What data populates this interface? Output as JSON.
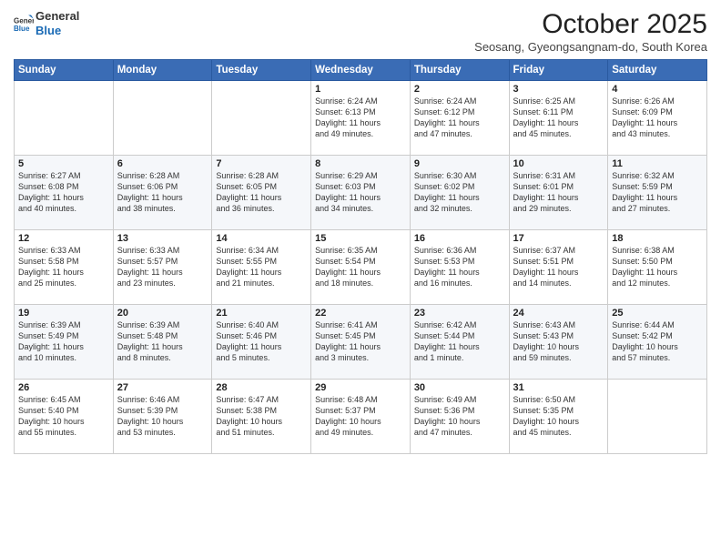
{
  "logo": {
    "line1": "General",
    "line2": "Blue"
  },
  "title": "October 2025",
  "subtitle": "Seosang, Gyeongsangnam-do, South Korea",
  "days_of_week": [
    "Sunday",
    "Monday",
    "Tuesday",
    "Wednesday",
    "Thursday",
    "Friday",
    "Saturday"
  ],
  "weeks": [
    [
      {
        "day": "",
        "info": ""
      },
      {
        "day": "",
        "info": ""
      },
      {
        "day": "",
        "info": ""
      },
      {
        "day": "1",
        "info": "Sunrise: 6:24 AM\nSunset: 6:13 PM\nDaylight: 11 hours\nand 49 minutes."
      },
      {
        "day": "2",
        "info": "Sunrise: 6:24 AM\nSunset: 6:12 PM\nDaylight: 11 hours\nand 47 minutes."
      },
      {
        "day": "3",
        "info": "Sunrise: 6:25 AM\nSunset: 6:11 PM\nDaylight: 11 hours\nand 45 minutes."
      },
      {
        "day": "4",
        "info": "Sunrise: 6:26 AM\nSunset: 6:09 PM\nDaylight: 11 hours\nand 43 minutes."
      }
    ],
    [
      {
        "day": "5",
        "info": "Sunrise: 6:27 AM\nSunset: 6:08 PM\nDaylight: 11 hours\nand 40 minutes."
      },
      {
        "day": "6",
        "info": "Sunrise: 6:28 AM\nSunset: 6:06 PM\nDaylight: 11 hours\nand 38 minutes."
      },
      {
        "day": "7",
        "info": "Sunrise: 6:28 AM\nSunset: 6:05 PM\nDaylight: 11 hours\nand 36 minutes."
      },
      {
        "day": "8",
        "info": "Sunrise: 6:29 AM\nSunset: 6:03 PM\nDaylight: 11 hours\nand 34 minutes."
      },
      {
        "day": "9",
        "info": "Sunrise: 6:30 AM\nSunset: 6:02 PM\nDaylight: 11 hours\nand 32 minutes."
      },
      {
        "day": "10",
        "info": "Sunrise: 6:31 AM\nSunset: 6:01 PM\nDaylight: 11 hours\nand 29 minutes."
      },
      {
        "day": "11",
        "info": "Sunrise: 6:32 AM\nSunset: 5:59 PM\nDaylight: 11 hours\nand 27 minutes."
      }
    ],
    [
      {
        "day": "12",
        "info": "Sunrise: 6:33 AM\nSunset: 5:58 PM\nDaylight: 11 hours\nand 25 minutes."
      },
      {
        "day": "13",
        "info": "Sunrise: 6:33 AM\nSunset: 5:57 PM\nDaylight: 11 hours\nand 23 minutes."
      },
      {
        "day": "14",
        "info": "Sunrise: 6:34 AM\nSunset: 5:55 PM\nDaylight: 11 hours\nand 21 minutes."
      },
      {
        "day": "15",
        "info": "Sunrise: 6:35 AM\nSunset: 5:54 PM\nDaylight: 11 hours\nand 18 minutes."
      },
      {
        "day": "16",
        "info": "Sunrise: 6:36 AM\nSunset: 5:53 PM\nDaylight: 11 hours\nand 16 minutes."
      },
      {
        "day": "17",
        "info": "Sunrise: 6:37 AM\nSunset: 5:51 PM\nDaylight: 11 hours\nand 14 minutes."
      },
      {
        "day": "18",
        "info": "Sunrise: 6:38 AM\nSunset: 5:50 PM\nDaylight: 11 hours\nand 12 minutes."
      }
    ],
    [
      {
        "day": "19",
        "info": "Sunrise: 6:39 AM\nSunset: 5:49 PM\nDaylight: 11 hours\nand 10 minutes."
      },
      {
        "day": "20",
        "info": "Sunrise: 6:39 AM\nSunset: 5:48 PM\nDaylight: 11 hours\nand 8 minutes."
      },
      {
        "day": "21",
        "info": "Sunrise: 6:40 AM\nSunset: 5:46 PM\nDaylight: 11 hours\nand 5 minutes."
      },
      {
        "day": "22",
        "info": "Sunrise: 6:41 AM\nSunset: 5:45 PM\nDaylight: 11 hours\nand 3 minutes."
      },
      {
        "day": "23",
        "info": "Sunrise: 6:42 AM\nSunset: 5:44 PM\nDaylight: 11 hours\nand 1 minute."
      },
      {
        "day": "24",
        "info": "Sunrise: 6:43 AM\nSunset: 5:43 PM\nDaylight: 10 hours\nand 59 minutes."
      },
      {
        "day": "25",
        "info": "Sunrise: 6:44 AM\nSunset: 5:42 PM\nDaylight: 10 hours\nand 57 minutes."
      }
    ],
    [
      {
        "day": "26",
        "info": "Sunrise: 6:45 AM\nSunset: 5:40 PM\nDaylight: 10 hours\nand 55 minutes."
      },
      {
        "day": "27",
        "info": "Sunrise: 6:46 AM\nSunset: 5:39 PM\nDaylight: 10 hours\nand 53 minutes."
      },
      {
        "day": "28",
        "info": "Sunrise: 6:47 AM\nSunset: 5:38 PM\nDaylight: 10 hours\nand 51 minutes."
      },
      {
        "day": "29",
        "info": "Sunrise: 6:48 AM\nSunset: 5:37 PM\nDaylight: 10 hours\nand 49 minutes."
      },
      {
        "day": "30",
        "info": "Sunrise: 6:49 AM\nSunset: 5:36 PM\nDaylight: 10 hours\nand 47 minutes."
      },
      {
        "day": "31",
        "info": "Sunrise: 6:50 AM\nSunset: 5:35 PM\nDaylight: 10 hours\nand 45 minutes."
      },
      {
        "day": "",
        "info": ""
      }
    ]
  ]
}
